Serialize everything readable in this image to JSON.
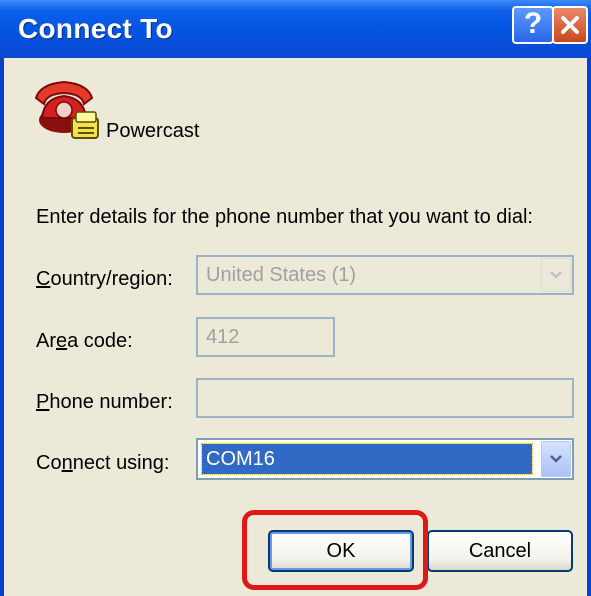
{
  "window": {
    "title": "Connect To",
    "help_glyph": "?"
  },
  "connection": {
    "name": "Powercast",
    "icon": "phone-connection-icon"
  },
  "instructions": "Enter details for the phone number that you want to dial:",
  "form": {
    "country": {
      "label_pre": "",
      "label_accel": "C",
      "label_post": "ountry/region:",
      "value": "United States (1)",
      "disabled": true
    },
    "area": {
      "label_pre": "Ar",
      "label_accel": "e",
      "label_post": "a code:",
      "value": "412",
      "disabled": true
    },
    "phone": {
      "label_pre": "",
      "label_accel": "P",
      "label_post": "hone number:",
      "value": ""
    },
    "connect": {
      "label_pre": "Co",
      "label_accel": "n",
      "label_post": "nect using:",
      "value": "COM16"
    }
  },
  "buttons": {
    "ok": "OK",
    "cancel": "Cancel"
  },
  "colors": {
    "titlebar": "#0554e2",
    "highlight_box": "#e01818",
    "selection": "#316ac5"
  }
}
